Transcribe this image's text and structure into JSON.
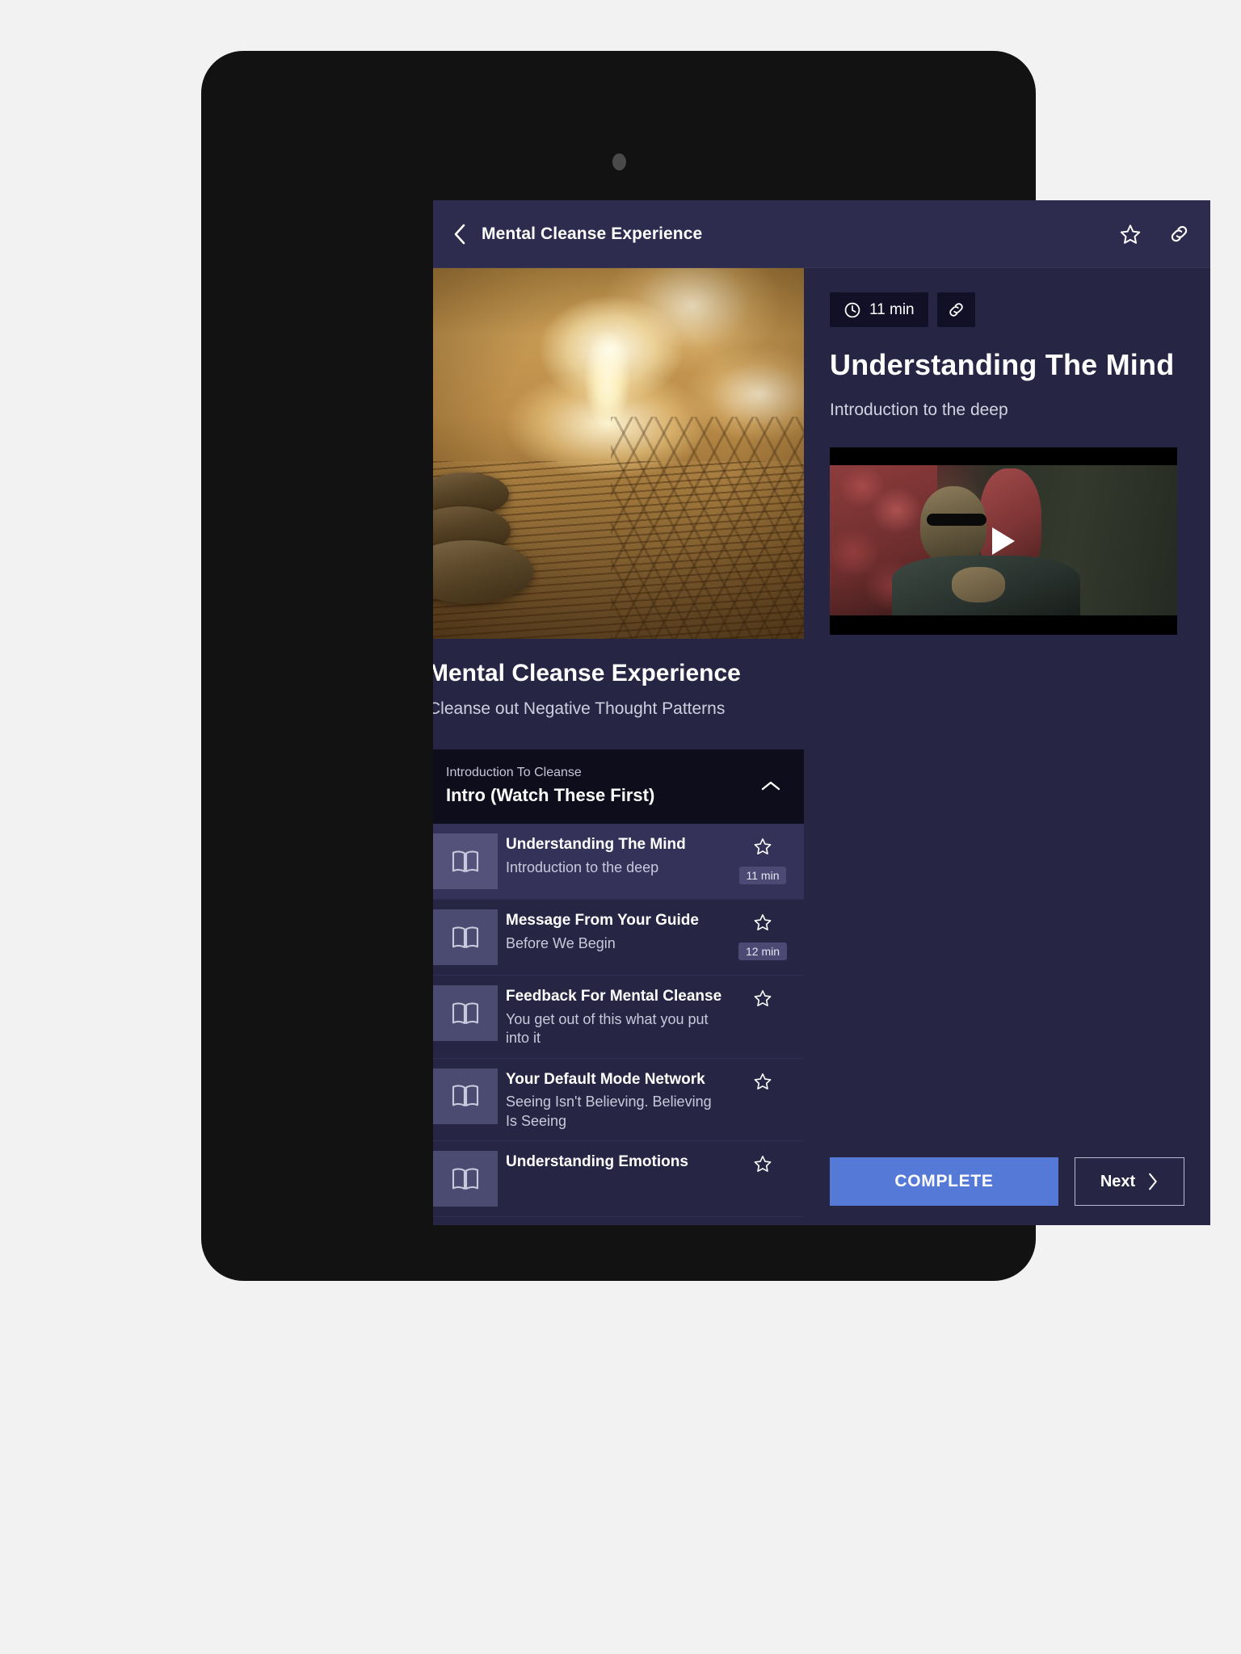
{
  "appbar": {
    "title": "Mental Cleanse Experience",
    "back_icon": "chevron-left-icon",
    "star_icon": "star-outline-icon",
    "link_icon": "link-icon"
  },
  "course": {
    "title": "Mental Cleanse Experience",
    "subtitle": "Cleanse out Negative Thought Patterns",
    "hero_image_alt": "candles-and-stones-spa-photo"
  },
  "section": {
    "eyebrow": "Introduction To Cleanse",
    "name": "Intro (Watch These First)",
    "toggle_icon": "chevron-up-icon",
    "expanded": true
  },
  "lessons": [
    {
      "title": "Understanding The Mind",
      "subtitle": "Introduction to the deep",
      "duration": "11 min",
      "icon": "book-icon",
      "star_icon": "star-outline-icon",
      "active": true
    },
    {
      "title": "Message From Your Guide",
      "subtitle": "Before We Begin",
      "duration": "12 min",
      "icon": "book-icon",
      "star_icon": "star-outline-icon",
      "active": false
    },
    {
      "title": "Feedback For Mental Cleanse",
      "subtitle": "You get out of this what you put into it",
      "duration": "",
      "icon": "book-icon",
      "star_icon": "star-outline-icon",
      "active": false
    },
    {
      "title": "Your Default Mode Network",
      "subtitle": "Seeing Isn't Believing. Believing Is Seeing",
      "duration": "",
      "icon": "book-icon",
      "star_icon": "star-outline-icon",
      "active": false
    },
    {
      "title": "Understanding Emotions",
      "subtitle": "",
      "duration": "",
      "icon": "book-icon",
      "star_icon": "star-outline-icon",
      "active": false
    }
  ],
  "detail": {
    "duration_chip": "11 min",
    "clock_icon": "clock-icon",
    "link_icon": "link-icon",
    "heading": "Understanding The Mind",
    "description": "Introduction to the deep",
    "video": {
      "play_icon": "play-icon",
      "thumbnail_alt": "matrix-morpheus-video-thumbnail"
    }
  },
  "footer": {
    "complete_label": "COMPLETE",
    "next_label": "Next",
    "next_icon": "chevron-right-icon"
  },
  "colors": {
    "accent": "#5479d6",
    "app_bg": "#272544",
    "appbar_bg": "#2d2b4e",
    "section_bg": "#0d0d1c",
    "active_row": "#343259"
  }
}
